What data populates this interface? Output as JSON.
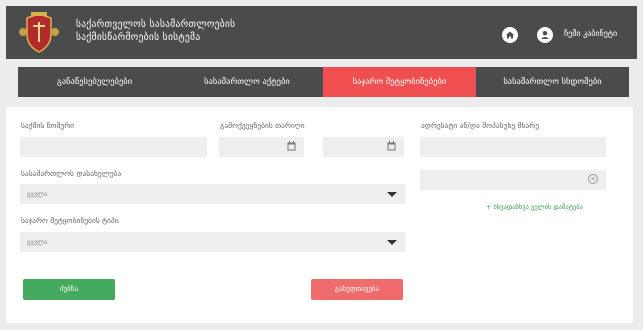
{
  "header": {
    "title_line1": "საქართველოს სასამართლოების",
    "title_line2": "საქმისწარმოების სისტემა",
    "user_label": "ჩემი კაბინეტი"
  },
  "tabs": [
    {
      "label": "განაწესებულებები",
      "active": false
    },
    {
      "label": "სასამართლო აქტები",
      "active": false
    },
    {
      "label": "საჯარო შეტყობინებები",
      "active": true
    },
    {
      "label": "სასამართლო სხდომები",
      "active": false
    }
  ],
  "form": {
    "case_number_label": "საქმის ნომერი",
    "publish_date_label": "გამოქვეყნების თარიღი",
    "address_label": "ადრესატი ან/და მოპასუხე მხარე",
    "court_name_label": "სასამართლოს დასახელება",
    "court_name_value": "ყველა",
    "notice_type_label": "საჯარო შეტყობინების ტიპი",
    "notice_type_value": "ყველა",
    "add_link": "+ სხვადასხვა ველის დამატება"
  },
  "buttons": {
    "search": "ძებნა",
    "clear": "გასუფთავება"
  },
  "colors": {
    "header_bg": "#4b4b4b",
    "active_tab": "#ef4f50",
    "search_btn": "#43aa60",
    "clear_btn": "#f06b6b",
    "link": "#3d9a5a"
  },
  "icons": {
    "home": "home-icon",
    "user": "user-icon",
    "calendar": "calendar-icon",
    "clear": "clear-circle-icon",
    "arrow": "chevron-down-icon",
    "logo": "coat-of-arms-logo"
  }
}
